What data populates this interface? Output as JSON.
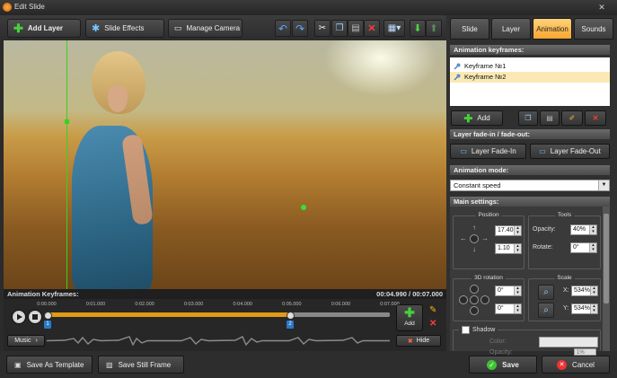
{
  "window": {
    "title": "Edit Slide"
  },
  "toolbar": {
    "add_layer": "Add Layer",
    "slide_effects": "Slide Effects",
    "manage_camera": "Manage Camera"
  },
  "preview": {
    "section_title": "Animation Keyframes:",
    "time_current": "00:04.990",
    "time_total": "00:07.000",
    "separator": "/"
  },
  "timeline": {
    "ticks": [
      "0:00.000",
      "0:01.000",
      "0:02.000",
      "0:03.000",
      "0:04.000",
      "0:05.000",
      "0:06.000",
      "0:07.000"
    ],
    "keyframe_marks": [
      "1",
      "2"
    ],
    "music_label": "Music",
    "add_label": "Add",
    "hide_label": "Hide"
  },
  "bottom": {
    "save_template": "Save As Template",
    "save_still": "Save Still Frame",
    "save": "Save",
    "cancel": "Cancel"
  },
  "tabs": [
    {
      "label": "Slide",
      "active": false
    },
    {
      "label": "Layer",
      "active": false
    },
    {
      "label": "Animation",
      "active": true
    },
    {
      "label": "Sounds",
      "active": false
    }
  ],
  "keyframes": {
    "title": "Animation keyframes:",
    "items": [
      {
        "label": "Keyframe №1",
        "selected": false
      },
      {
        "label": "Keyframe №2",
        "selected": true
      }
    ],
    "add_label": "Add"
  },
  "fade": {
    "title": "Layer fade-in / fade-out:",
    "fade_in": "Layer Fade-In",
    "fade_out": "Layer Fade-Out"
  },
  "mode": {
    "title": "Animation mode:",
    "value": "Constant speed"
  },
  "main": {
    "title": "Main settings:",
    "position_label": "Position",
    "tools_label": "Tools",
    "pos_x": "17.40",
    "pos_y": "1.10",
    "opacity_label": "Opacity:",
    "opacity_value": "40%",
    "rotate_label": "Rotate:",
    "rotate_value": "0°",
    "rotation3d_label": "3D rotation",
    "rot3d_a": "0°",
    "rot3d_b": "0°",
    "scale_label": "Scale",
    "scale_x_label": "X:",
    "scale_x": "534%",
    "scale_y_label": "Y:",
    "scale_y": "534%",
    "shadow_label": "Shadow",
    "shadow_color_label": "Color:",
    "shadow_opacity_label": "Opacity:",
    "shadow_opacity": "1%"
  },
  "colors": {
    "accent": "#f7a630",
    "track": "#e09a14",
    "guide": "#39d21f"
  }
}
